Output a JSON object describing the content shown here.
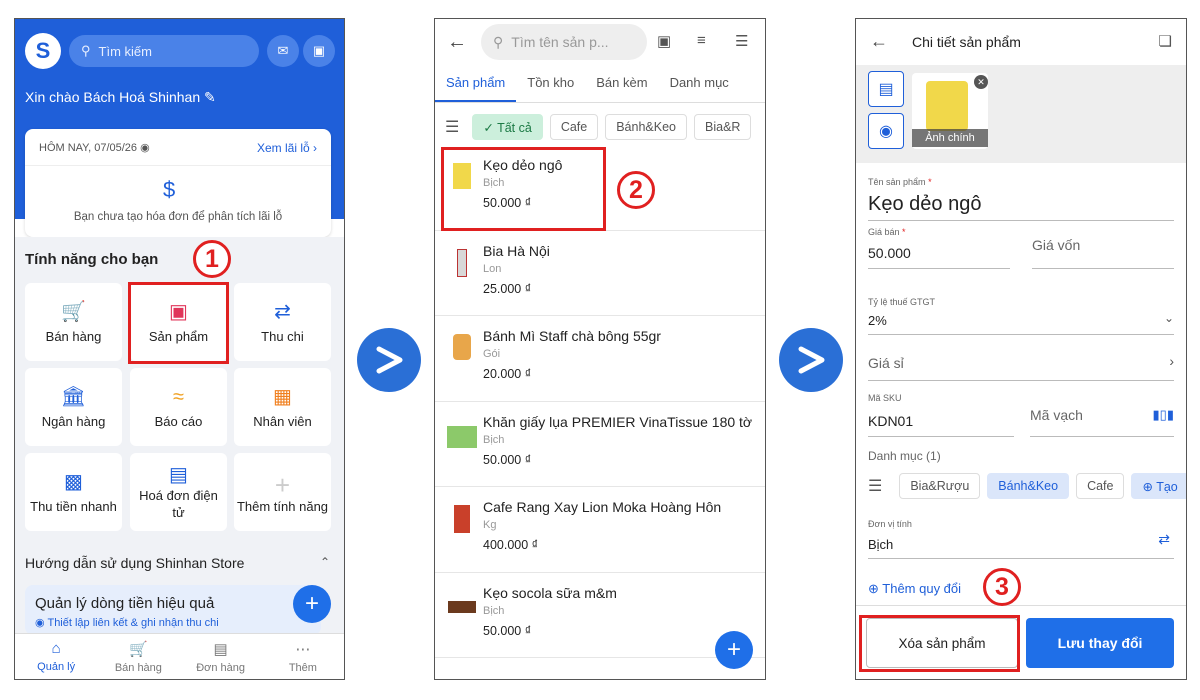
{
  "colors": {
    "primary": "#1f5fd9",
    "highlight": "#e02020",
    "chip_active": "#ccefdc",
    "arrow": "#2a6fd6"
  },
  "markers": [
    "1",
    "2",
    "3"
  ],
  "screen1": {
    "search_placeholder": "Tìm kiếm",
    "greeting": "Xin chào Bách Hoá Shinhan",
    "report": {
      "date": "HÔM NAY, 07/05/26",
      "review_link": "Xem lãi lỗ ›",
      "empty_text": "Bạn chưa tạo hóa đơn để phân tích lãi lỗ"
    },
    "features_title": "Tính năng cho bạn",
    "features": [
      {
        "label": "Bán hàng",
        "icon": "cart-plus-icon"
      },
      {
        "label": "Sản phẩm",
        "icon": "box-icon"
      },
      {
        "label": "Thu chi",
        "icon": "transfer-icon"
      },
      {
        "label": "Ngân hàng",
        "icon": "bank-icon"
      },
      {
        "label": "Báo cáo",
        "icon": "chart-icon"
      },
      {
        "label": "Nhân viên",
        "icon": "badge-icon"
      },
      {
        "label": "Thu tiền nhanh",
        "icon": "qr-icon"
      },
      {
        "label": "Hoá đơn điện tử",
        "icon": "invoice-icon"
      },
      {
        "label": "Thêm tính năng",
        "icon": "plus-icon"
      }
    ],
    "guide_title": "Hướng dẫn sử dụng Shinhan Store",
    "promo_title": "Quản lý dòng tiền hiệu quả",
    "promo_sub": "Thiết lập liên kết & ghi nhận thu chi",
    "nav": [
      {
        "label": "Quản lý"
      },
      {
        "label": "Bán hàng"
      },
      {
        "label": "Đơn hàng"
      },
      {
        "label": "Thêm"
      }
    ]
  },
  "screen2": {
    "search_placeholder": "Tìm tên sản p...",
    "tabs": [
      "Sản phẩm",
      "Tồn kho",
      "Bán kèm",
      "Danh mục"
    ],
    "chips": [
      "✓ Tất cả",
      "Cafe",
      "Bánh&Keo",
      "Bia&R"
    ],
    "products": [
      {
        "name": "Kẹo dẻo ngô",
        "unit": "Bịch",
        "price": "50.000 ₫",
        "color": "#f1d84a"
      },
      {
        "name": "Bia Hà Nội",
        "unit": "Lon",
        "price": "25.000 ₫",
        "color": "#d8d8d8"
      },
      {
        "name": "Bánh Mì Staff chà bông 55gr",
        "unit": "Gói",
        "price": "20.000 ₫",
        "color": "#e8a64a"
      },
      {
        "name": "Khăn giấy lụa PREMIER VinaTissue 180 tờ",
        "unit": "Bịch",
        "price": "50.000 ₫",
        "color": "#8cc96a"
      },
      {
        "name": "Cafe Rang Xay Lion Moka Hoàng Hôn",
        "unit": "Kg",
        "price": "400.000 ₫",
        "color": "#c9402a"
      },
      {
        "name": "Kẹo socola sữa m&m",
        "unit": "Bịch",
        "price": "50.000 ₫",
        "color": "#6b3a1e"
      }
    ]
  },
  "screen3": {
    "title": "Chi tiết sản phẩm",
    "main_image_label": "Ảnh chính",
    "name_label": "Tên sản phẩm",
    "name_value": "Kẹo dẻo ngô",
    "price_label": "Giá bán",
    "price_value": "50.000",
    "cost_placeholder": "Giá vốn",
    "vat_label": "Tỷ lệ thuế GTGT",
    "vat_value": "2%",
    "wholesale": "Giá sỉ",
    "sku_label": "Mã SKU",
    "sku_value": "KDN01",
    "barcode_placeholder": "Mã vạch",
    "category_label": "Danh mục (1)",
    "categories": [
      "Bia&Rượu",
      "Bánh&Keo",
      "Cafe",
      "⊕ Tạo"
    ],
    "unit_label": "Đơn vị tính",
    "unit_value": "Bịch",
    "convert_link": "⊕ Thêm quy đổi",
    "delete_button": "Xóa sản phẩm",
    "save_button": "Lưu thay đổi"
  }
}
